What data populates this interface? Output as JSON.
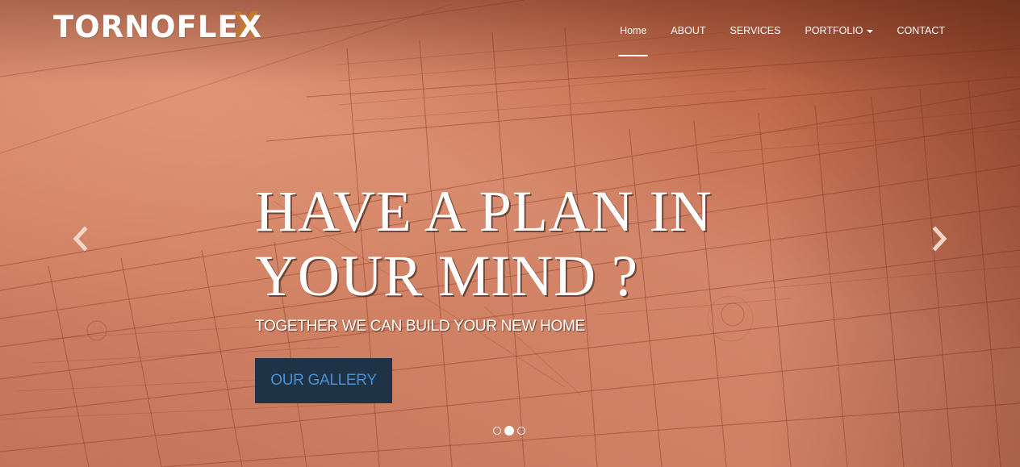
{
  "brand": {
    "name": "TORNOFLEX"
  },
  "nav": {
    "items": [
      {
        "label": "Home",
        "active": true
      },
      {
        "label": "ABOUT"
      },
      {
        "label": "SERVICES"
      },
      {
        "label": "PORTFOLIO",
        "dropdown": true
      },
      {
        "label": "CONTACT"
      }
    ]
  },
  "hero": {
    "headline_line1": "HAVE A PLAN IN",
    "headline_line2": "YOUR MIND ?",
    "subline": "TOGETHER WE CAN BUILD YOUR NEW HOME",
    "cta_label": "OUR GALLERY",
    "prev_icon": "chevron-left-icon",
    "next_icon": "chevron-right-icon",
    "slide_count": 3,
    "active_slide": 2
  },
  "colors": {
    "overlay": "#c9785a",
    "cta_bg": "#1e3346",
    "cta_text": "#4a8fd0",
    "logo_accent": "#c87a28"
  }
}
